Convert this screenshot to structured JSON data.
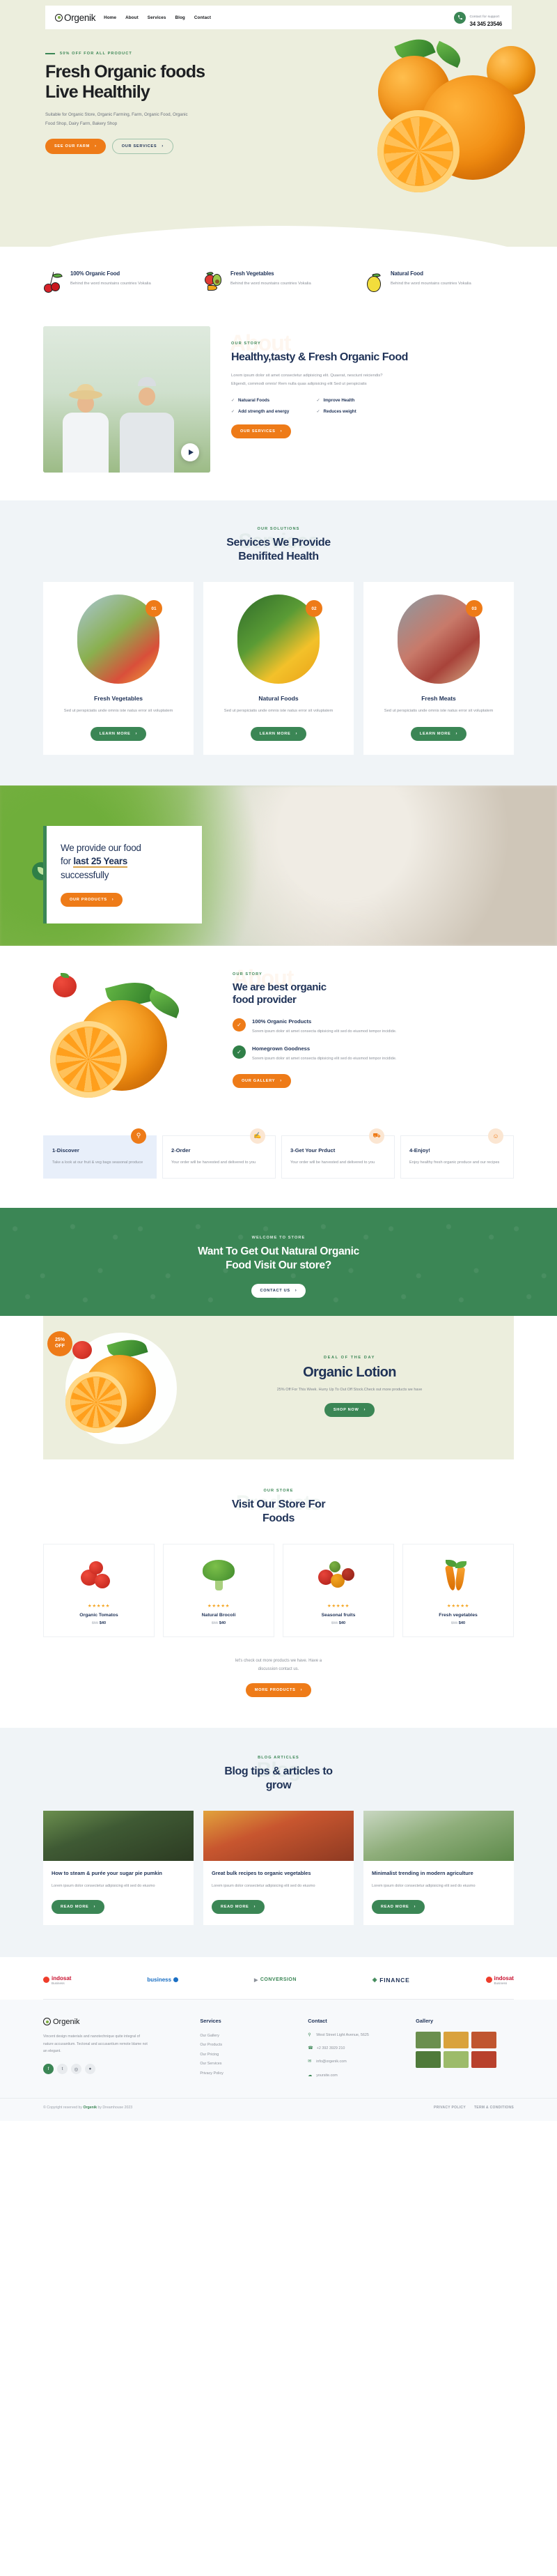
{
  "brand": {
    "name": "Orgenik",
    "icon": "recycle-leaf-icon"
  },
  "header": {
    "nav": [
      {
        "label": "Home"
      },
      {
        "label": "About"
      },
      {
        "label": "Services"
      },
      {
        "label": "Blog"
      },
      {
        "label": "Contact"
      }
    ],
    "support_label": "Contact for support",
    "support_phone": "34 345 23546",
    "phone_icon": "phone-icon"
  },
  "hero": {
    "eyebrow": "50% OFF FOR ALL PRODUCT",
    "title_line1": "Fresh Organic foods",
    "title_line2": "Live Healthily",
    "subtitle": "Suitable for Organic Store, Organic Farming, Farm, Organic Food, Organic Food Shop, Dairy Farm, Bakery Shop",
    "primary_btn": "SEE OUR FARM",
    "secondary_btn": "OUR SERVICES",
    "chevron": "›"
  },
  "features": [
    {
      "icon": "cherry-icon",
      "title": "100% Organic Food",
      "text": "Behind the word mountains countries Vokalia"
    },
    {
      "icon": "vegetables-icon",
      "title": "Fresh Vegetables",
      "text": "Behind the word mountains countries Vokalia"
    },
    {
      "icon": "lemon-icon",
      "title": "Natural Food",
      "text": "Behind the word mountains countries Vokalia"
    }
  ],
  "story": {
    "ghost": "About",
    "kicker": "OUR STORY",
    "title": "Healthy,tasty & Fresh Organic Food",
    "lead": "Lorem ipsum dolor sit amet consectetur adipisicing elit. Quaerat, nesciunt reiciendis? Eligendi, commodi omnis! Rem nulla quas adipisicing elit Sed ut perspiciatis",
    "checks": [
      "Natuaral Foods",
      "Improve Health",
      "Add strength and energy",
      "Reduces weight"
    ],
    "check_icon": "check-icon",
    "button": "OUR SERVICES",
    "play_icon": "play-icon",
    "media_alt": "two-farmers-photo"
  },
  "services": {
    "ghost": "Services",
    "kicker": "OUR SOLUTIONS",
    "title_line1": "Services We Provide",
    "title_line2": "Benifited Health",
    "cards": [
      {
        "badge": "01",
        "title": "Fresh Vegetables",
        "text": "Sed ut perspiciatis unde omnis iste natus error sit voluptatem",
        "button": "LEARN MORE",
        "image": "vegetables-basket-photo"
      },
      {
        "badge": "02",
        "title": "Natural Foods",
        "text": "Sed ut perspiciatis unde omnis iste natus error sit voluptatem",
        "button": "LEARN MORE",
        "image": "lemon-tree-photo"
      },
      {
        "badge": "03",
        "title": "Fresh Meats",
        "text": "Sed ut perspiciatis unde omnis iste natus error sit voluptatem",
        "button": "LEARN MORE",
        "image": "raw-meat-photo"
      }
    ]
  },
  "years": {
    "line1": "We provide our food",
    "line2_pre": "for ",
    "line2_bold": "last 25 Years",
    "line3": "successfully",
    "button": "OUR PRODUCTS",
    "badge_icon": "leaf-icon"
  },
  "provider": {
    "ghost": "About",
    "kicker": "OUR STORY",
    "title_line1": "We are best organic",
    "title_line2": "food provider",
    "items": [
      {
        "icon": "check-icon",
        "color": "#ee7b18",
        "title": "100% Organic Products",
        "text": "Sorem ipsum dolor sit amet consecta dipisicing elit sed do eiusmod tempor incidide."
      },
      {
        "icon": "check-icon",
        "color": "#2f7f47",
        "title": "Homegrown Goodness",
        "text": "Sorem ipsum dolor sit amet consecta dipisicing elit sed do eiusmod tempor incidide."
      }
    ],
    "button": "OUR GALLERY"
  },
  "steps": [
    {
      "icon": "search-icon",
      "title": "1-Discover",
      "text": "Take a look at our fruit & veg bags seasonal produce",
      "active": true
    },
    {
      "icon": "hand-icon",
      "title": "2-Order",
      "text": "Your order will be harvested and delivered to you",
      "active": false
    },
    {
      "icon": "truck-icon",
      "title": "3-Get Your Prduct",
      "text": "Your order will be harvested and delivered to you",
      "active": false
    },
    {
      "icon": "smile-icon",
      "title": "4-Enjoy!",
      "text": "Enjoy healthy fresh organic produce and our recipes",
      "active": false
    }
  ],
  "cta": {
    "kicker": "WELCOME TO STORE",
    "title_line1": "Want To Get Out Natural Organic",
    "title_line2": "Food Visit Our store?",
    "button": "CONTACT US"
  },
  "deal": {
    "badge_line1": "25%",
    "badge_line2": "OFF",
    "kicker": "DEAL OF THE DAY",
    "title": "Organic Lotion",
    "text": "25% Off For This Week. Hurry Up To Out Off Stock.Check out more products we have",
    "button": "SHOP NOW"
  },
  "store": {
    "ghost": "Products",
    "kicker": "OUR STORE",
    "title_line1": "Visit Our Store For",
    "title_line2": "Foods",
    "products": [
      {
        "stars": "★★★★★",
        "name": "Organic Tomatos",
        "price_old": "$55",
        "price_new": "$40",
        "image": "tomatoes-icon"
      },
      {
        "stars": "★★★★★",
        "name": "Natural Brocoli",
        "price_old": "$55",
        "price_new": "$40",
        "image": "broccoli-icon"
      },
      {
        "stars": "★★★★★",
        "name": "Seasonal fruits",
        "price_old": "$55",
        "price_new": "$40",
        "image": "fruits-icon"
      },
      {
        "stars": "★★★★★",
        "name": "Fresh vegetables",
        "price_old": "$55",
        "price_new": "$40",
        "image": "carrots-icon"
      }
    ],
    "note_line1": "let's check out more products we have. Have a",
    "note_line2": "discussion contact us.",
    "button": "MORE PRODUCTS"
  },
  "blog": {
    "ghost": "Blog",
    "kicker": "BLOG ARTICLES",
    "title_line1": "Blog tips & articles to",
    "title_line2": "grow",
    "posts": [
      {
        "title": "How to steam & purée your sugar pie pumkin",
        "text": "Lorem ipsum dolor consectetur adipisicing elit sed do eiusmo",
        "button": "READ MORE",
        "image": "garden-rows-photo"
      },
      {
        "title": "Great bulk recipes to organic vegetables",
        "text": "Lorem ipsum dolor consectetur adipisicing elit sed do eiusmo",
        "button": "READ MORE",
        "image": "peppers-photo"
      },
      {
        "title": "Minimalist trending in modern agriculture",
        "text": "Lorem ipsum dolor consectetur adipisicing elit sed do eiusmo",
        "button": "READ MORE",
        "image": "greenhouse-photo"
      }
    ]
  },
  "partners": [
    {
      "name": "indosat",
      "sub": "Business"
    },
    {
      "name": "business",
      "sub": ""
    },
    {
      "name": "CONVERSION",
      "sub": ""
    },
    {
      "name": "FINANCE",
      "sub": ""
    },
    {
      "name": "indosat",
      "sub": "Business"
    }
  ],
  "footer": {
    "brand_text": "Vincent design materials and nanotechnique quite integral of nature accusantium. Tectonal and accusantium remote blame not an elegant.",
    "socials": [
      {
        "icon": "facebook-icon",
        "glyph": "f"
      },
      {
        "icon": "twitter-icon",
        "glyph": "t"
      },
      {
        "icon": "instagram-icon",
        "glyph": "◎"
      },
      {
        "icon": "dribbble-icon",
        "glyph": "●"
      }
    ],
    "services": {
      "title": "Services",
      "items": [
        "Our Gallery",
        "Our Products",
        "Our Pricing",
        "Our Services",
        "Privacy Policy"
      ]
    },
    "contact": {
      "title": "Contact",
      "items": [
        {
          "icon": "location-icon",
          "text": "West Street Light Avenue, 5625"
        },
        {
          "icon": "phone-icon",
          "text": "+2 392 3929 210"
        },
        {
          "icon": "mail-icon",
          "text": "info@orgenik.com"
        },
        {
          "icon": "globe-icon",
          "text": "yoursite.com"
        }
      ]
    },
    "gallery": {
      "title": "Gallery",
      "cells": [
        "#6b8f4e",
        "#d9a23c",
        "#c0562f",
        "#4f7a3a",
        "#9cbb6a",
        "#b8412c"
      ]
    }
  },
  "copyright": {
    "text_pre": "© Copyright reserved by ",
    "text_bold": "Orgenik",
    "text_post": " by Dreamhouse 2023",
    "links": [
      "PRIVACY POLICY",
      "TERM & CONDITIONS"
    ]
  },
  "colors": {
    "green": "#3b8655",
    "orange": "#ee7b18",
    "navy": "#1f3257",
    "cream": "#eceedd",
    "lightblue": "#f0f4f7"
  }
}
